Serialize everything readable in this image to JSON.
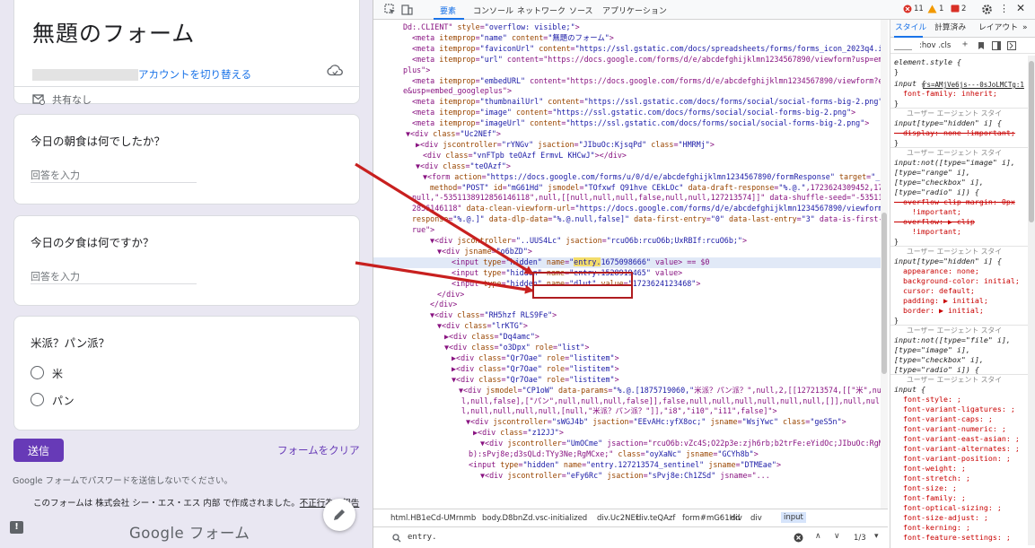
{
  "form": {
    "title": "無題のフォーム",
    "switch_account": "アカウントを切り替える",
    "share_status": "共有なし",
    "questions": [
      {
        "title": "今日の朝食は何でしたか？",
        "placeholder": "回答を入力"
      },
      {
        "title": "今日の夕食は何ですか？",
        "placeholder": "回答を入力"
      },
      {
        "title": "米派？パン派？",
        "options": [
          "米",
          "パン"
        ]
      }
    ],
    "submit_label": "送信",
    "clear_label": "フォームをクリア",
    "password_note": "Google フォームでパスワードを送信しないでください。",
    "created_note_prefix": "このフォームは 株式会社 シー・エス・エス 内部 で作成されました。",
    "created_note_link": "不正行為の報告",
    "logo_text": "Google フォーム",
    "icons": [
      "cloud-icon",
      "mail-share-icon",
      "feedback-icon",
      "pencil-icon"
    ],
    "accent_color": "#673ab7"
  },
  "devtools": {
    "tabs": [
      "要素",
      "コンソール",
      "ネットワーク",
      "ソース",
      "アプリケーション"
    ],
    "badges": {
      "errors": "11",
      "warnings": "1",
      "issues": "2"
    },
    "tree_lines": [
      {
        "indent": 0,
        "html": "Dd:.CLIENT\" style=\"overflow: visible;\">"
      },
      {
        "indent": 1,
        "tag": "meta",
        "attrs": [
          [
            "itemprop",
            "name"
          ],
          [
            "content",
            "無題のフォーム"
          ]
        ]
      },
      {
        "indent": 1,
        "tag": "meta",
        "attrs": [
          [
            "itemprop",
            "faviconUrl"
          ],
          [
            "content",
            "https://ssl.gstatic.com/docs/spreadsheets/forms/forms_icon_2023q4.ico"
          ]
        ]
      },
      {
        "indent": 1,
        "tag": "meta",
        "attrs": [
          [
            "itemprop",
            "url"
          ],
          [
            "content",
            "https://docs.google.com/forms/d/e/abcdefghijklmn1234567890/viewform?usp=embed_googleplus"
          ]
        ]
      },
      {
        "indent": 1,
        "tag": "meta",
        "attrs": [
          [
            "itemprop",
            "embedURL"
          ],
          [
            "content",
            "https://docs.google.com/forms/d/e/abcdefghijklmn1234567890/viewform?embedded=true&usp=embed_googleplus"
          ]
        ]
      },
      {
        "indent": 1,
        "tag": "meta",
        "attrs": [
          [
            "itemprop",
            "thumbnailUrl"
          ],
          [
            "content",
            "https://ssl.gstatic.com/docs/forms/social/social-forms-big-2.png"
          ]
        ]
      },
      {
        "indent": 1,
        "tag": "meta",
        "attrs": [
          [
            "itemprop",
            "image"
          ],
          [
            "content",
            "https://ssl.gstatic.com/docs/forms/social/social-forms-big-2.png"
          ]
        ]
      },
      {
        "indent": 1,
        "tag": "meta",
        "attrs": [
          [
            "itemprop",
            "imageUrl"
          ],
          [
            "content",
            "https://ssl.gstatic.com/docs/forms/social/social-forms-big-2.png"
          ]
        ]
      }
    ],
    "tree_text": [
      "Dd:.CLIENT\" style=\"overflow: visible;\">",
      "<meta itemprop=\"name\" content=\"無題のフォーム\">",
      "<meta itemprop=\"faviconUrl\" content=\"https://ssl.gstatic.com/docs/spreadsheets/forms/forms_icon_2023q4.ico\">",
      "<meta itemprop=\"url\" content=\"https://docs.google.com/forms/d/e/abcdefghijklmn1234567890/viewform?usp=embed_google",
      "plus\">",
      "<meta itemprop=\"embedURL\" content=\"https://docs.google.com/forms/d/e/abcdefghijklmn1234567890/viewform?embedded=tru",
      "e&usp=embed_googleplus\">",
      "<meta itemprop=\"thumbnailUrl\" content=\"https://ssl.gstatic.com/docs/forms/social/social-forms-big-2.png\">",
      "<meta itemprop=\"image\" content=\"https://ssl.gstatic.com/docs/forms/social/social-forms-big-2.png\">",
      "<meta itemprop=\"imageUrl\" content=\"https://ssl.gstatic.com/docs/forms/social/social-forms-big-2.png\">",
      "▼<div class=\"Uc2NEf\">",
      "▶<div jscontroller=\"rYNGv\" jsaction=\"JIbuOc:KjsqPd\" class=\"HMRMj\">",
      "<div class=\"vnFTpb teOAzf ErmvL KHCwJ\"></div>",
      "▼<div class=\"teOAzf\">",
      "▼<form action=\"https://docs.google.com/forms/u/0/d/e/abcdefghijklmn1234567890/formResponse\" target=\"_self\"",
      "method=\"POST\" id=\"mG61Hd\" jsmodel=\"TOfxwf Q91hve CEkLOc\" data-draft-response=\"%.@.\",1723624309452,1723624123466",
      "null,\"-5351138912856146118\",null,[[null,null,null,false,null,null,127213574]]\" data-shuffle-seed=\"-5351138912",
      "2856146118\" data-clean-viewform-url=\"https://docs.google.com/forms/d/e/abcdefghijklmn1234567890/viewform\" data-",
      "response=\"%.@.]\" data-dlp-data=\"%.@.null,false]\" data-first-entry=\"0\" data-last-entry=\"3\" data-is-first-page=\"t",
      "rue\">",
      "▼<div jscontroller=\"..UUS4Lc\" jsaction=\"rcuO6b:rcuO6b;UxRBIf:rcuO6b;\">",
      "▼<div jsname=\"o6bZD\">",
      "<input type=\"hidden\" name=\"entry.1675098666\" value> == $0",
      "<input type=\"hidden\" name=\"entry.1528919465\" value>",
      "<input type=\"hidden\" name=\"dlut\" value=\"1723624123468\">",
      "</div>",
      "</div>",
      "▼<div class=\"RH5hzf RLS9Fe\">",
      "▼<div class=\"lrKTG\">",
      "▶<div class=\"Dq4amc\">",
      "▼<div class=\"o3Dpx\" role=\"list\">",
      "▶<div class=\"Qr7Oae\" role=\"listitem\">",
      "▶<div class=\"Qr7Oae\" role=\"listitem\">",
      "▼<div class=\"Qr7Oae\" role=\"listitem\">",
      "▼<div jsmodel=\"CP1oW\" data-params=\"%.@.[1875719060,\"米派？パン派？\",null,2,[[127213574,[[\"米\",null,nul",
      "l,null,false],[\"パン\",null,null,null,false]],false,null,null,null,null,null,null,[]],null,nul",
      "l,null,null,null,null,[null,\"米派？パン派？\"]],\"i8\",\"i10\",\"i11\",false]\">",
      "▼<div jscontroller=\"sWGJ4b\" jsaction=\"EEvAHc:yfX8oc;\" jsname=\"WsjYwc\" class=\"geS5n\">",
      "▶<div class=\"z12JJ\">",
      "▼<div jscontroller=\"UmOCme\" jsaction=\"rcuO6b:vZc4S;O22p3e:zjh6rb;b2trFe:eYidOc;JIbuOc:RgMCxe(YICLK",
      "b):sPvj8e;d3sQLd:TYy3Ne;RgMCxe;\" class=\"oyXaNc\" jsname=\"GCYh8b\">",
      "<input type=\"hidden\" name=\"entry.127213574_sentinel\" jsname=\"DTMEae\">",
      "▼<div jscontroller=\"eFy6Rc\" jsaction=\"sPvj8e:Ch1ZSd\" jsname=\"..."
    ],
    "highlight_term": "entry.",
    "breadcrumbs": [
      "html.HB1eCd-UMrnmb",
      "body.D8bnZd.vsc-initialized",
      "div.Uc2NEf",
      "div.teQAzf",
      "form#mG61Hd",
      "div",
      "div",
      "input"
    ],
    "search_value": "entry.",
    "search_count": "1/3",
    "styles_tabs": [
      "スタイル",
      "計算済み",
      "レイアウト"
    ],
    "styles_filter": ":hov .cls",
    "styles_lines": [
      "element.style {",
      "}",
      "input {",
      "  font-family: inherit;",
      "}",
      "ユーザー エージェント スタイ",
      "input[type=\"hidden\" i] {",
      "  display: none !important;",
      "}",
      "ユーザー エージェント スタイ",
      "input:not([type=\"image\" i],",
      "[type=\"range\" i],",
      "[type=\"checkbox\" i],",
      "[type=\"radio\" i]) {",
      "  overflow-clip-margin: 0px",
      "    !important;",
      "  overflow: ▶ clip",
      "    !important;",
      "}",
      "ユーザー エージェント スタイ",
      "input[type=\"hidden\" i] {",
      "  appearance: none;",
      "  background-color: initial;",
      "  cursor: default;",
      "  padding: ▶ initial;",
      "  border: ▶ initial;",
      "}",
      "ユーザー エージェント スタイ",
      "input:not([type=\"file\" i],",
      "[type=\"image\" i],",
      "[type=\"checkbox\" i],",
      "[type=\"radio\" i]) {",
      "ユーザー エージェント スタイ",
      "input {",
      "  font-style: ;",
      "  font-variant-ligatures: ;",
      "  font-variant-caps: ;",
      "  font-variant-numeric: ;",
      "  font-variant-east-asian: ;",
      "  font-variant-alternates: ;",
      "  font-variant-position: ;",
      "  font-weight: ;",
      "  font-stretch: ;",
      "  font-size: ;",
      "  font-family: ;",
      "  font-optical-sizing: ;",
      "  font-size-adjust: ;",
      "  font-kerning: ;",
      "  font-feature-settings: ;"
    ],
    "styles_source": "rs=AMjVe6js---0sJoLMCTg:1"
  }
}
